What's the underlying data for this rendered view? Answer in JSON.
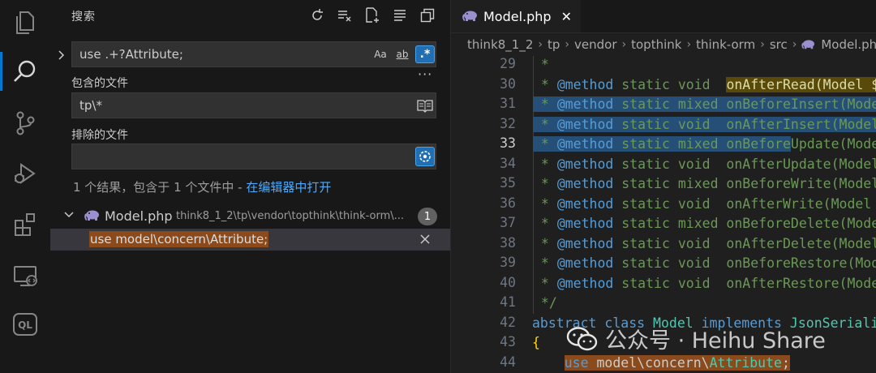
{
  "activity_bar": {
    "items": [
      {
        "icon": "explorer-icon"
      },
      {
        "icon": "search-icon",
        "active": true
      },
      {
        "icon": "source-control-icon"
      },
      {
        "icon": "run-debug-icon"
      },
      {
        "icon": "extensions-icon"
      },
      {
        "icon": "remote-explorer-icon"
      },
      {
        "icon": "ql-icon",
        "text": "QL"
      }
    ]
  },
  "search": {
    "title": "搜索",
    "actions": [
      "refresh-icon",
      "clear-results-icon",
      "new-search-editor-icon",
      "collapse-all-icon",
      "open-in-editor-icon"
    ],
    "query": "use .+?Attribute;",
    "options": {
      "match_case": "Aa",
      "whole_word": "ab",
      "regex": ".*"
    },
    "include_label": "包含的文件",
    "include_value": "tp\\*",
    "exclude_label": "排除的文件",
    "exclude_value": "",
    "more": "···",
    "results_summary": "1 个结果，包含于 1 个文件中 - ",
    "open_in_editor_link": "在编辑器中打开",
    "file": {
      "name": "Model.php",
      "path": "think8_1_2\\tp\\vendor\\topthink\\think-orm\\...",
      "count": "1"
    },
    "match": "use model\\concern\\Attribute;"
  },
  "editor": {
    "tab": {
      "label": "Model.php",
      "close": "✕"
    },
    "breadcrumbs": [
      "think8_1_2",
      "tp",
      "vendor",
      "topthink",
      "think-orm",
      "src",
      "Model.php"
    ],
    "current_line": 33,
    "lines": [
      {
        "n": "29",
        "text": " *"
      },
      {
        "n": "30",
        "text": " * @method static void  onAfterRead(Model $model)"
      },
      {
        "n": "31",
        "text": " * @method static mixed onBeforeInsert(Model $model)"
      },
      {
        "n": "32",
        "text": " * @method static void  onAfterInsert(Model $model)"
      },
      {
        "n": "33",
        "text": " * @method static mixed onBeforeUpdate(Model $model)"
      },
      {
        "n": "34",
        "text": " * @method static void  onAfterUpdate(Model $model)"
      },
      {
        "n": "35",
        "text": " * @method static mixed onBeforeWrite(Model $model)"
      },
      {
        "n": "36",
        "text": " * @method static void  onAfterWrite(Model $model)"
      },
      {
        "n": "37",
        "text": " * @method static mixed onBeforeDelete(Model $model)"
      },
      {
        "n": "38",
        "text": " * @method static void  onAfterDelete(Model $model)"
      },
      {
        "n": "39",
        "text": " * @method static void  onBeforeRestore(Model $model)"
      },
      {
        "n": "40",
        "text": " * @method static void  onAfterRestore(Model $model)"
      },
      {
        "n": "41",
        "text": " */"
      },
      {
        "n": "42",
        "text": "abstract class Model implements JsonSerializable"
      },
      {
        "n": "43",
        "text": "{"
      },
      {
        "n": "44",
        "text": "    use model\\concern\\Attribute;"
      }
    ]
  },
  "watermark": {
    "text": "公众号 · Heihu Share"
  },
  "colors": {
    "accent": "#0078d4",
    "link": "#4daafc",
    "match_highlight": "#8a4a1c",
    "selection": "#264f78"
  }
}
